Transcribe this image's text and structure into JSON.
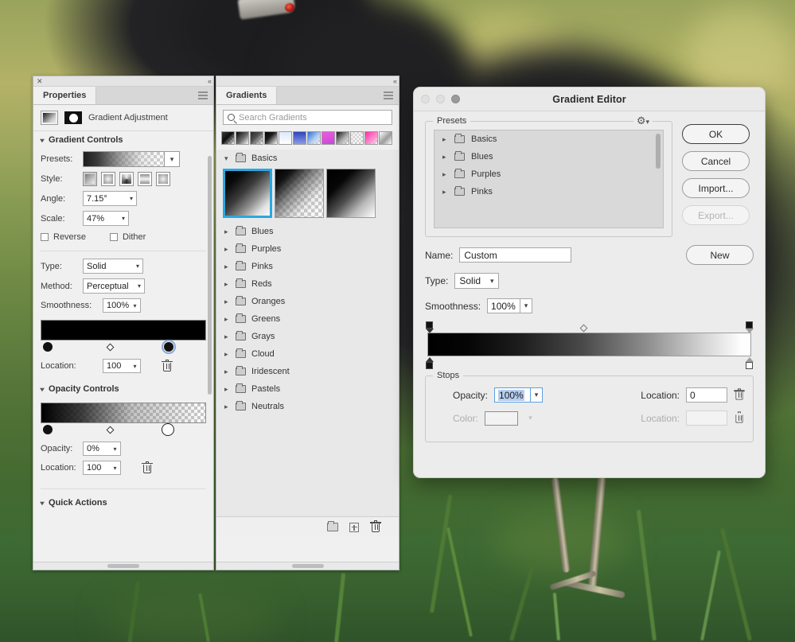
{
  "properties_panel": {
    "tab_label": "Properties",
    "close_icon": "close-icon",
    "collapse_icon": "collapse-panel-icon",
    "menu_icon": "panel-menu-icon",
    "adjustment_label": "Gradient Adjustment",
    "sections": {
      "gradient_controls": {
        "title": "Gradient Controls",
        "presets_label": "Presets:",
        "style_label": "Style:",
        "styles": [
          "linear",
          "radial",
          "angle",
          "reflected",
          "diamond"
        ],
        "style_selected_index": 0,
        "angle_label": "Angle:",
        "angle_value": "7.15°",
        "scale_label": "Scale:",
        "scale_value": "47%",
        "reverse_label": "Reverse",
        "reverse_checked": false,
        "dither_label": "Dither",
        "dither_checked": false,
        "type_label": "Type:",
        "type_value": "Solid",
        "method_label": "Method:",
        "method_value": "Perceptual",
        "smoothness_label": "Smoothness:",
        "smoothness_value": "100%",
        "location_label": "Location:",
        "location_value": "100",
        "delete_icon": "trash-icon"
      },
      "opacity_controls": {
        "title": "Opacity Controls",
        "opacity_label": "Opacity:",
        "opacity_value": "0%",
        "location_label": "Location:",
        "location_value": "100",
        "delete_icon": "trash-icon"
      },
      "quick_actions": {
        "title": "Quick Actions"
      }
    }
  },
  "gradients_panel": {
    "tab_label": "Gradients",
    "collapse_icon": "collapse-panel-icon",
    "menu_icon": "panel-menu-icon",
    "search": {
      "placeholder": "Search Gradients",
      "value": "",
      "icon": "search-icon"
    },
    "recent_swatches": [
      "linear-gradient(135deg,#3a3a3a,#0d0d0d 45%,rgba(255,255,255,0))",
      "linear-gradient(135deg,#0a0a0a,#6e6e6e 55%,#fbfbfb)",
      "linear-gradient(135deg,#2a2a2a,#4d4d4d 40%,rgba(255,255,255,0))",
      "linear-gradient(135deg,#000,#1b1b1b 40%,#ffffff)",
      "linear-gradient(180deg,#dce9fb,#ffffff)",
      "linear-gradient(180deg,#2f43bb,#8b9ae8)",
      "linear-gradient(135deg,#2f6fd6,#bcd4f2 60%,rgba(255,255,255,0))",
      "linear-gradient(160deg,#f05ae0,#c34bd8)",
      "linear-gradient(135deg,#151515,#b5b5b5 60%,rgba(255,255,255,0))",
      "linear-gradient(135deg,rgba(230,230,230,.7),rgba(255,255,255,0))",
      "linear-gradient(135deg,#ff2ea6,#ff8fd0 60%,rgba(255,255,255,0))",
      "linear-gradient(135deg,#ffffff,#9c9c9c 55%,#ffffff)"
    ],
    "groups": [
      {
        "label": "Basics",
        "expanded": true
      },
      {
        "label": "Blues",
        "expanded": false
      },
      {
        "label": "Purples",
        "expanded": false
      },
      {
        "label": "Pinks",
        "expanded": false
      },
      {
        "label": "Reds",
        "expanded": false
      },
      {
        "label": "Oranges",
        "expanded": false
      },
      {
        "label": "Greens",
        "expanded": false
      },
      {
        "label": "Grays",
        "expanded": false
      },
      {
        "label": "Cloud",
        "expanded": false
      },
      {
        "label": "Iridescent",
        "expanded": false
      },
      {
        "label": "Pastels",
        "expanded": false
      },
      {
        "label": "Neutrals",
        "expanded": false
      }
    ],
    "basics_swatches": [
      {
        "name": "foreground-to-background",
        "selected": true
      },
      {
        "name": "foreground-to-transparent",
        "selected": false
      },
      {
        "name": "black-to-white",
        "selected": false
      }
    ],
    "footer": {
      "new_group_icon": "new-folder-icon",
      "new_gradient_icon": "add-gradient-icon",
      "delete_icon": "trash-icon"
    }
  },
  "gradient_editor": {
    "title": "Gradient Editor",
    "window_buttons": [
      "close",
      "minimize",
      "zoom"
    ],
    "presets": {
      "legend": "Presets",
      "gear_icon": "gear-icon",
      "items": [
        {
          "label": "Basics"
        },
        {
          "label": "Blues"
        },
        {
          "label": "Purples"
        },
        {
          "label": "Pinks"
        }
      ]
    },
    "buttons": {
      "ok": "OK",
      "cancel": "Cancel",
      "import": "Import...",
      "export": "Export...",
      "export_disabled": true,
      "new": "New"
    },
    "name_label": "Name:",
    "name_value": "Custom",
    "type_label": "Type:",
    "type_value": "Solid",
    "smoothness_label": "Smoothness:",
    "smoothness_value": "100%",
    "stops": {
      "legend": "Stops",
      "opacity_label": "Opacity:",
      "opacity_value": "100%",
      "opacity_selected": true,
      "opacity_location_label": "Location:",
      "opacity_location_value": "0",
      "color_label": "Color:",
      "color_value": "#f2f2f2",
      "color_location_label": "Location:",
      "color_location_value": "",
      "delete_icon": "trash-icon"
    }
  },
  "theme": {
    "accent_selection": "#29a8e0",
    "panel_bg": "#f0f0f0",
    "dialog_bg": "#ececec",
    "text": "#2b2b2b",
    "text_selection_bg": "#b5cef0"
  }
}
